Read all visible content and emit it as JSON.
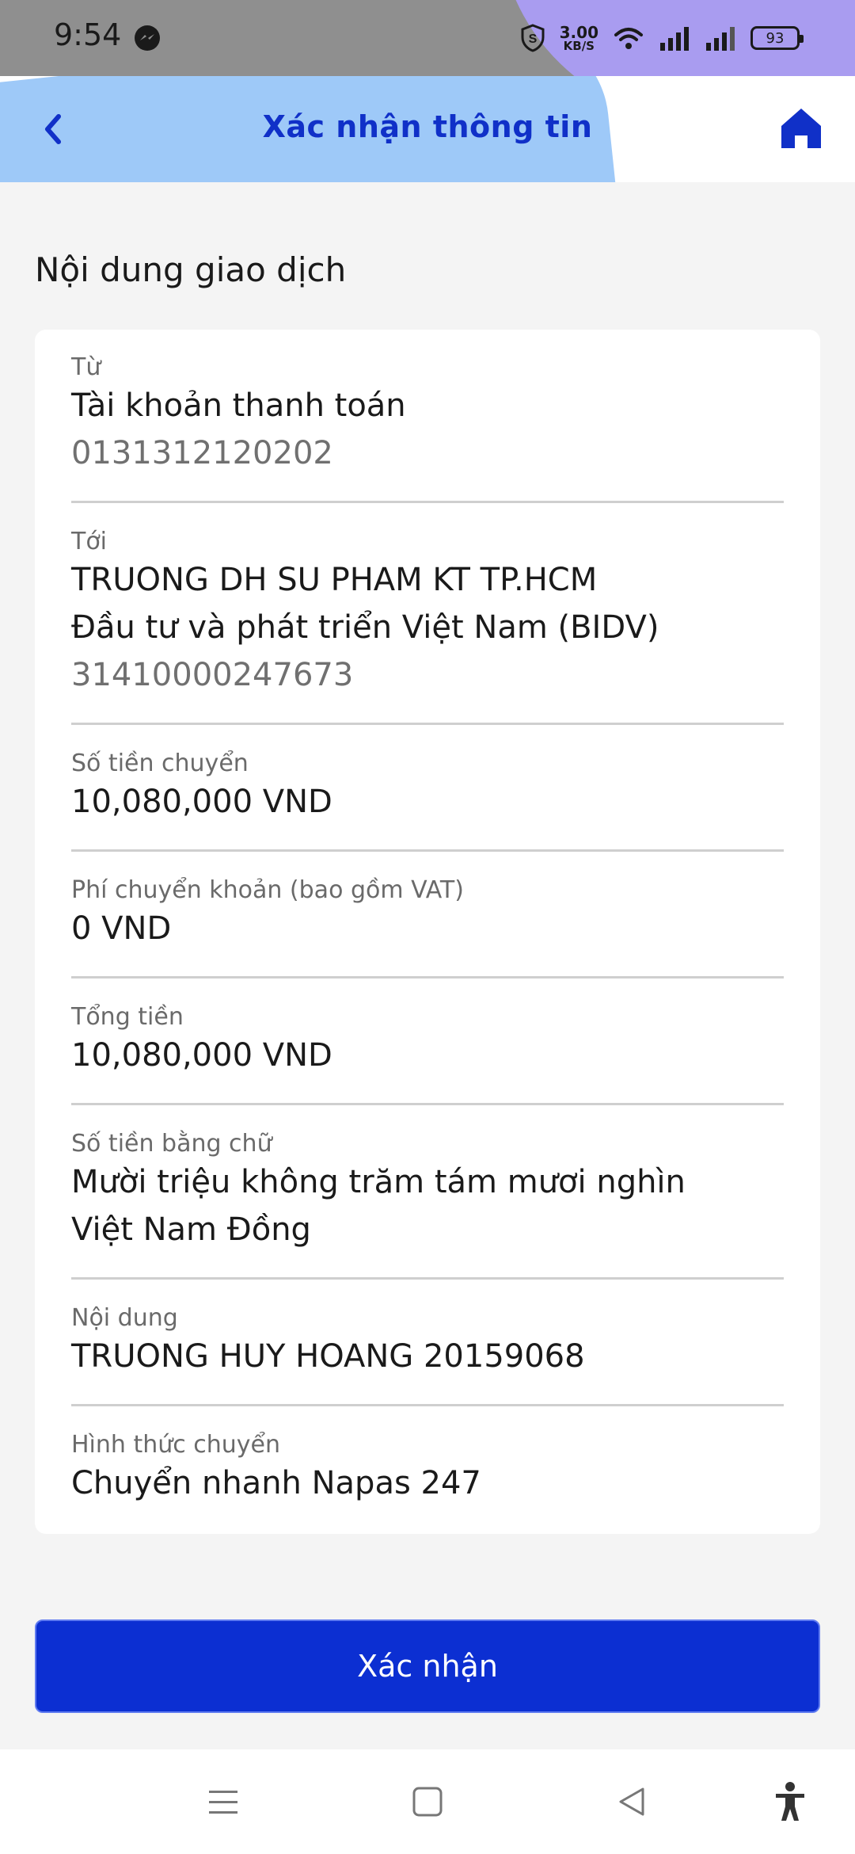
{
  "status_bar": {
    "time": "9:54",
    "speed_value": "3.00",
    "speed_unit": "KB/S",
    "battery": "93",
    "icons": [
      "messenger-icon",
      "shield-icon",
      "wifi-icon",
      "signal-icon",
      "signal-icon",
      "battery-icon"
    ]
  },
  "header": {
    "title": "Xác nhận thông tin",
    "back_icon": "chevron-left-icon",
    "home_icon": "home-icon"
  },
  "section_title": "Nội dung giao dịch",
  "fields": {
    "from": {
      "label": "Từ",
      "value": "Tài khoản thanh toán",
      "sub": "0131312120202"
    },
    "to": {
      "label": "Tới",
      "value_line1": "TRUONG DH SU PHAM KT TP.HCM",
      "value_line2": "Đầu tư và phát triển Việt Nam (BIDV)",
      "sub": "31410000247673"
    },
    "amount": {
      "label": "Số tiền chuyển",
      "value": "10,080,000 VND"
    },
    "fee": {
      "label": "Phí chuyển khoản (bao gồm VAT)",
      "value": "0 VND"
    },
    "total": {
      "label": "Tổng tiền",
      "value": "10,080,000 VND"
    },
    "amount_words": {
      "label": "Số tiền bằng chữ",
      "value_line1": "Mười triệu không trăm tám mươi nghìn",
      "value_line2": "Việt Nam Đồng"
    },
    "content": {
      "label": "Nội dung",
      "value": "TRUONG HUY HOANG 20159068"
    },
    "method": {
      "label": "Hình thức chuyển",
      "value": "Chuyển nhanh Napas 247"
    }
  },
  "confirm_button": "Xác nhận",
  "colors": {
    "primary": "#0c2fd2",
    "title_blue": "#1030c8",
    "header_wave": "#9ec9f8",
    "status_accent": "#a99cf0"
  }
}
